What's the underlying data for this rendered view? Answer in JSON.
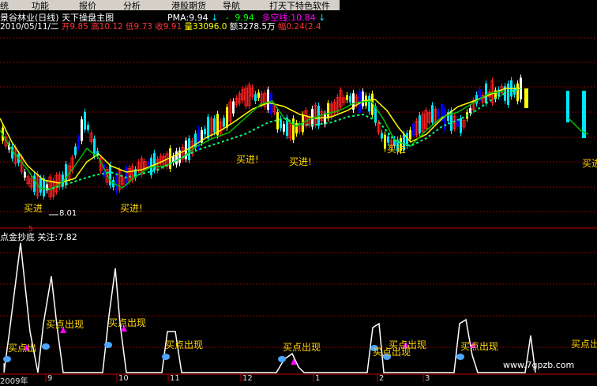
{
  "menu": [
    "统",
    "功能",
    "报价",
    "分析",
    "港股期货",
    "导航",
    "打天下特色软件"
  ],
  "header": {
    "stock": "景谷林业(日线)",
    "template": "天下操盘主图",
    "pma_label": "PMA:",
    "pma_value": "9.94",
    "pma_arrow": "↓",
    "dash": "-",
    "pma2_value": "9.94",
    "trend_label": "多空线:",
    "trend_value": "10.84",
    "trend_arrow": "↓"
  },
  "ohlc": {
    "date": "2010/05/11/二",
    "open_label": "开",
    "open": "9.85",
    "high_label": "高",
    "high": "10.12",
    "low_label": "低",
    "low": "9.73",
    "close_label": "收",
    "close": "9.91",
    "vol_label": "量",
    "vol": "33096.0",
    "amt_label": "额",
    "amt": "3278.5万",
    "chg_label": "幅",
    "chg": "0.24(2.4"
  },
  "main_chart": {
    "buy_labels": [
      "买进",
      "买进!",
      "买进!",
      "买进!",
      "买进",
      "买进!"
    ],
    "low_marker": "8.01",
    "five_marker": "5"
  },
  "indicator": {
    "name": "点金抄底",
    "attn_label": "关注:",
    "attn_value": "7.82",
    "signal_labels": [
      "买点出",
      "买点出现",
      "买点出现",
      "买点出现",
      "买点出现",
      "买点出现",
      "买点出现",
      "买点出现",
      "买点出现"
    ]
  },
  "x_axis": [
    "2009年",
    "9",
    "10",
    "11",
    "12",
    "1",
    "2",
    "3"
  ],
  "watermark": "www.7gpzb.com",
  "colors": {
    "up": "#ff2020",
    "down": "#00e5ff",
    "yellow": "#ffff00",
    "green": "#00c000",
    "grid": "#8b0000",
    "magenta": "#ff00ff"
  }
}
